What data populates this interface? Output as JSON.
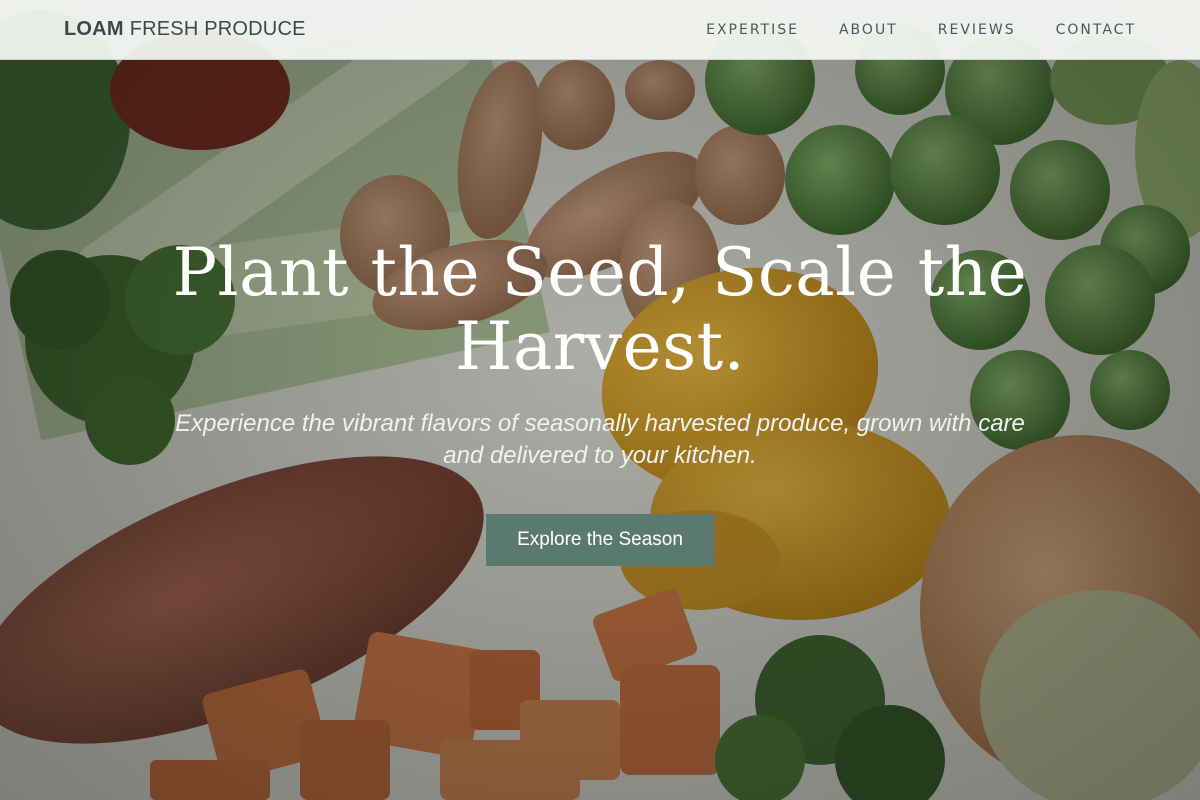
{
  "header": {
    "logo_brand": "LOAM",
    "logo_rest": "FRESH PRODUCE",
    "nav": [
      "EXPERTISE",
      "ABOUT",
      "REVIEWS",
      "CONTACT"
    ]
  },
  "hero": {
    "headline": "Plant the Seed, Scale the Harvest.",
    "subhead": "Experience the vibrant flavors of seasonally harvested produce, grown with care and delivered to your kitchen.",
    "cta_label": "Explore the Season"
  },
  "colors": {
    "cta": "#5a7a71",
    "header_bg": "#f4f6f3",
    "logo_text": "#3b4a48"
  }
}
